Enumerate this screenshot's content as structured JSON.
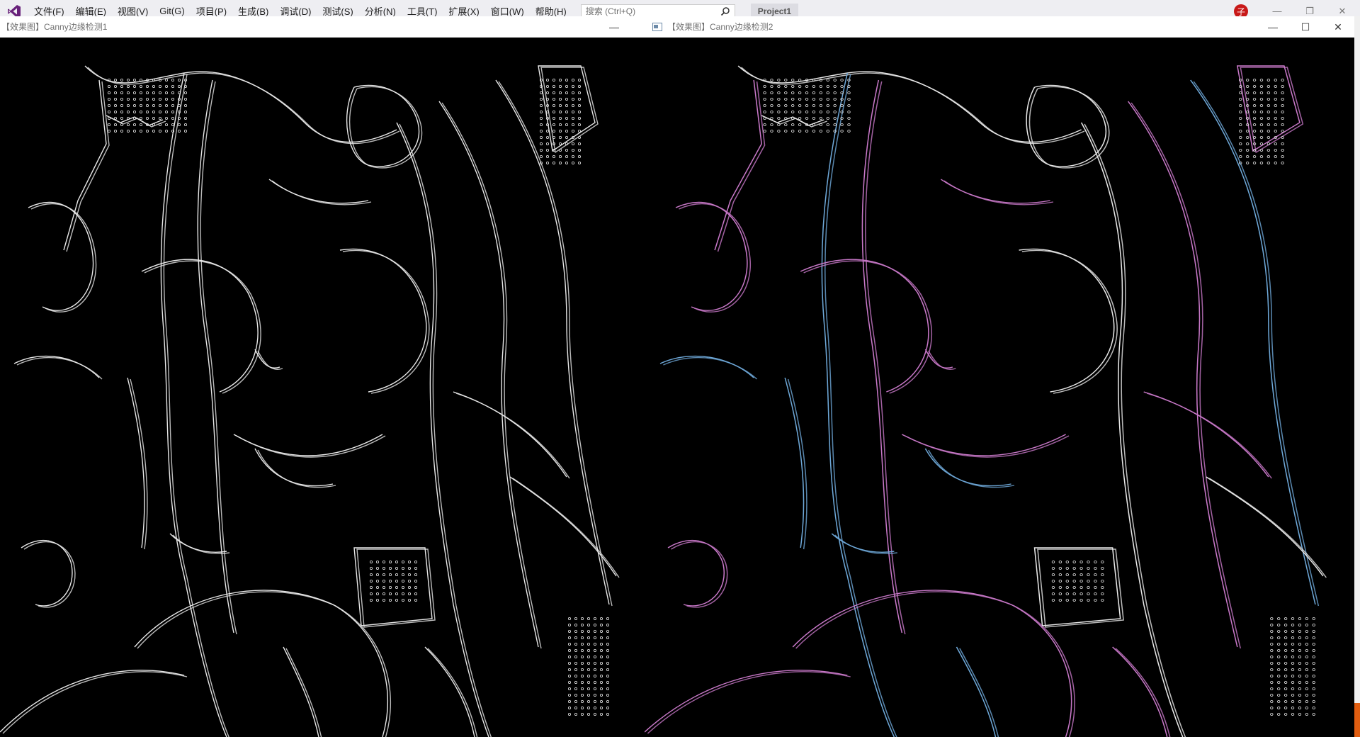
{
  "vs": {
    "menu": [
      {
        "label": "文件(F)"
      },
      {
        "label": "编辑(E)"
      },
      {
        "label": "视图(V)"
      },
      {
        "label": "Git(G)"
      },
      {
        "label": "项目(P)"
      },
      {
        "label": "生成(B)"
      },
      {
        "label": "调试(D)"
      },
      {
        "label": "测试(S)"
      },
      {
        "label": "分析(N)"
      },
      {
        "label": "工具(T)"
      },
      {
        "label": "扩展(X)"
      },
      {
        "label": "窗口(W)"
      },
      {
        "label": "帮助(H)"
      }
    ],
    "search_placeholder": "搜索 (Ctrl+Q)",
    "project_name": "Project1",
    "user_initial": "子"
  },
  "window1": {
    "title": "【效果图】Canny边缘检测1",
    "minimize_glyph": "—"
  },
  "window2": {
    "title": "【效果图】Canny边缘检测2",
    "minimize_glyph": "—",
    "maximize_glyph": "☐",
    "close_glyph": "✕"
  },
  "colors": {
    "accent": "#e05d10",
    "user_badge": "#c81818",
    "edge_white": "#e8e8e8",
    "edge_pink": "#c878c8",
    "edge_blue": "#6ea8d8"
  }
}
